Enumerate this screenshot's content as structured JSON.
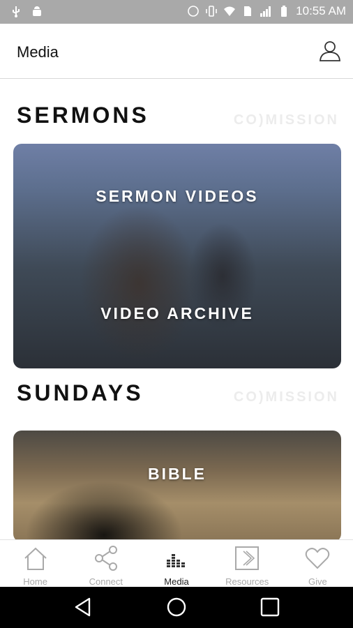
{
  "status_bar": {
    "time": "10:55 AM",
    "icons": [
      "usb-icon",
      "android-debug-icon",
      "sync-icon",
      "vibrate-icon",
      "wifi-icon",
      "sim-icon",
      "signal-icon",
      "battery-icon"
    ]
  },
  "app_bar": {
    "title": "Media",
    "account_icon": "person-icon"
  },
  "sections": [
    {
      "title": "SERMONS",
      "watermark": "CO)MISSION",
      "links": [
        "SERMON VIDEOS",
        "VIDEO ARCHIVE"
      ]
    },
    {
      "title": "SUNDAYS",
      "watermark": "CO)MISSION",
      "links": [
        "BIBLE"
      ]
    }
  ],
  "bottom_nav": {
    "items": [
      {
        "label": "Home",
        "icon": "home-icon"
      },
      {
        "label": "Connect",
        "icon": "share-icon"
      },
      {
        "label": "Media",
        "icon": "equalizer-icon"
      },
      {
        "label": "Resources",
        "icon": "chevron-right-icon"
      },
      {
        "label": "Give",
        "icon": "heart-icon"
      }
    ],
    "active": "Media"
  },
  "system_nav": [
    "back-icon",
    "home-circle-icon",
    "recents-icon"
  ],
  "colors": {
    "status_bar": "#a9a9a9",
    "nav_inactive": "#a9a9a9",
    "nav_active": "#222222",
    "system_nav": "#000000"
  }
}
